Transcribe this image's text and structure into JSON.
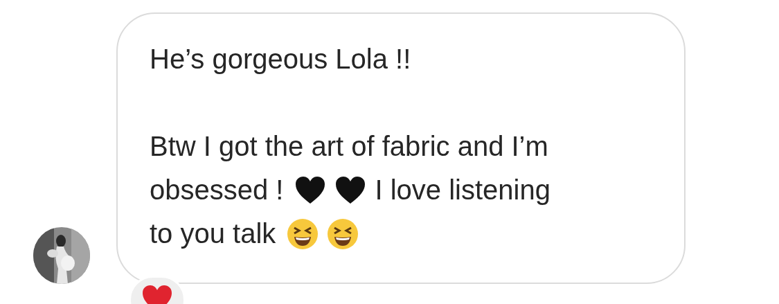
{
  "message": {
    "paragraphs": [
      [
        [
          {
            "kind": "text",
            "text": "He’s gorgeous Lola !!"
          }
        ]
      ],
      [
        [
          {
            "kind": "text",
            "text": "Btw I got the art of fabric and I’m"
          }
        ],
        [
          {
            "kind": "text",
            "text": "obsessed !"
          },
          {
            "kind": "heart"
          },
          {
            "kind": "heart"
          },
          {
            "kind": "text",
            "text": "I love listening"
          }
        ],
        [
          {
            "kind": "text",
            "text": "to you talk"
          },
          {
            "kind": "laugh"
          },
          {
            "kind": "laugh"
          }
        ]
      ]
    ],
    "avatar": {
      "kind": "picture"
    },
    "reaction": {
      "kind": "red-heart"
    }
  }
}
